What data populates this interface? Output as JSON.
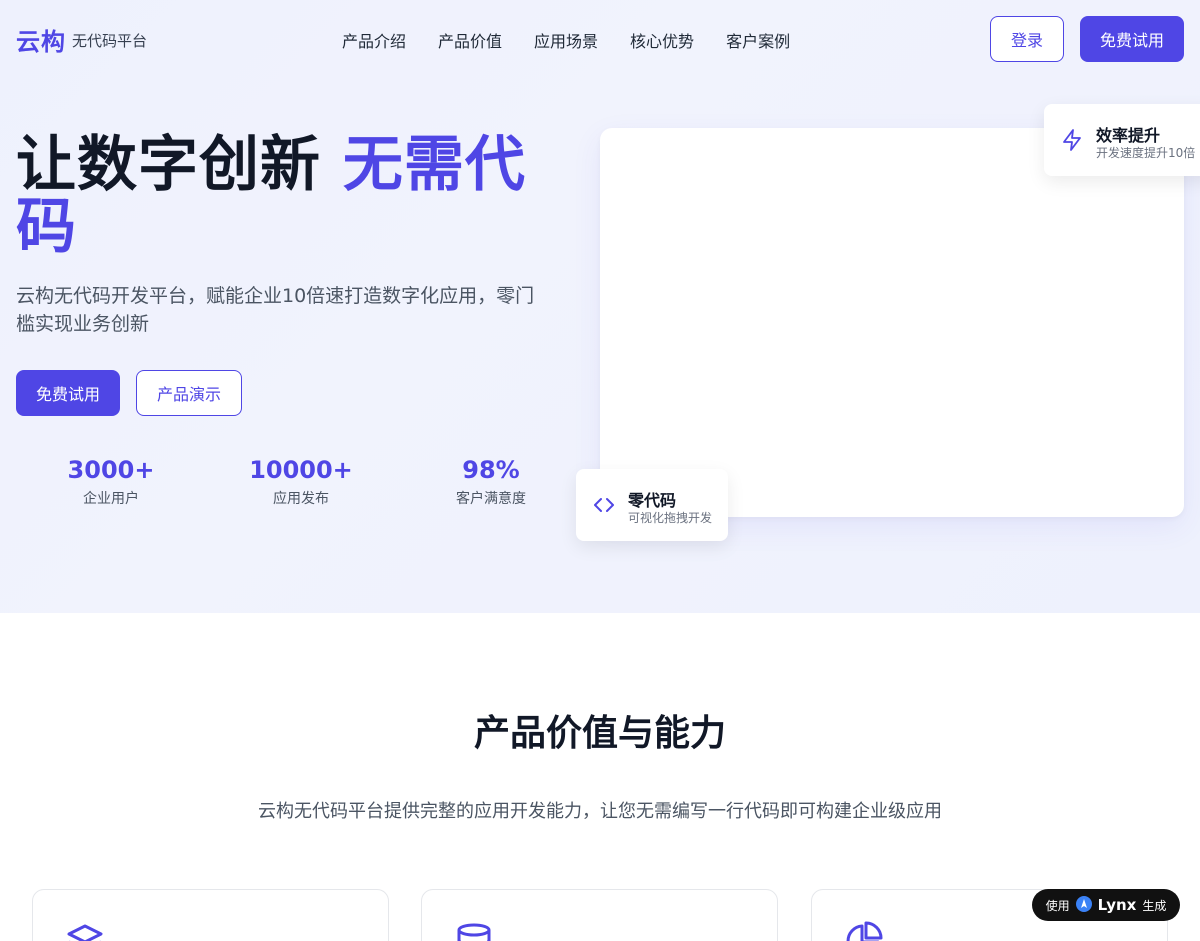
{
  "header": {
    "logo": "云构",
    "logo_sub": "无代码平台",
    "nav": [
      "产品介绍",
      "产品价值",
      "应用场景",
      "核心优势",
      "客户案例"
    ],
    "login_label": "登录",
    "trial_label": "免费试用"
  },
  "hero": {
    "title_main": "让数字创新 ",
    "title_accent": "无需代码",
    "description": "云构无代码开发平台，赋能企业10倍速打造数字化应用，零门槛实现业务创新",
    "primary_button": "免费试用",
    "secondary_button": "产品演示",
    "stats": [
      {
        "value": "3000+",
        "label": "企业用户"
      },
      {
        "value": "10000+",
        "label": "应用发布"
      },
      {
        "value": "98%",
        "label": "客户满意度"
      }
    ]
  },
  "float_cards": {
    "efficiency": {
      "title": "效率提升",
      "subtitle": "开发速度提升10倍",
      "icon": "lightning-icon"
    },
    "nocode": {
      "title": "零代码",
      "subtitle": "可视化拖拽开发",
      "icon": "code-icon"
    }
  },
  "section": {
    "title": "产品价值与能力",
    "description": "云构无代码平台提供完整的应用开发能力，让您无需编写一行代码即可构建企业级应用",
    "feature_icons": [
      "layers-icon",
      "database-icon",
      "pie-chart-icon"
    ]
  },
  "badge": {
    "prefix": "使用",
    "brand": "Lynx",
    "suffix": "生成"
  },
  "colors": {
    "accent": "#4f46e5",
    "hero_bg": "#eef1fd",
    "text_dark": "#111827",
    "text_muted": "#4b5563"
  }
}
